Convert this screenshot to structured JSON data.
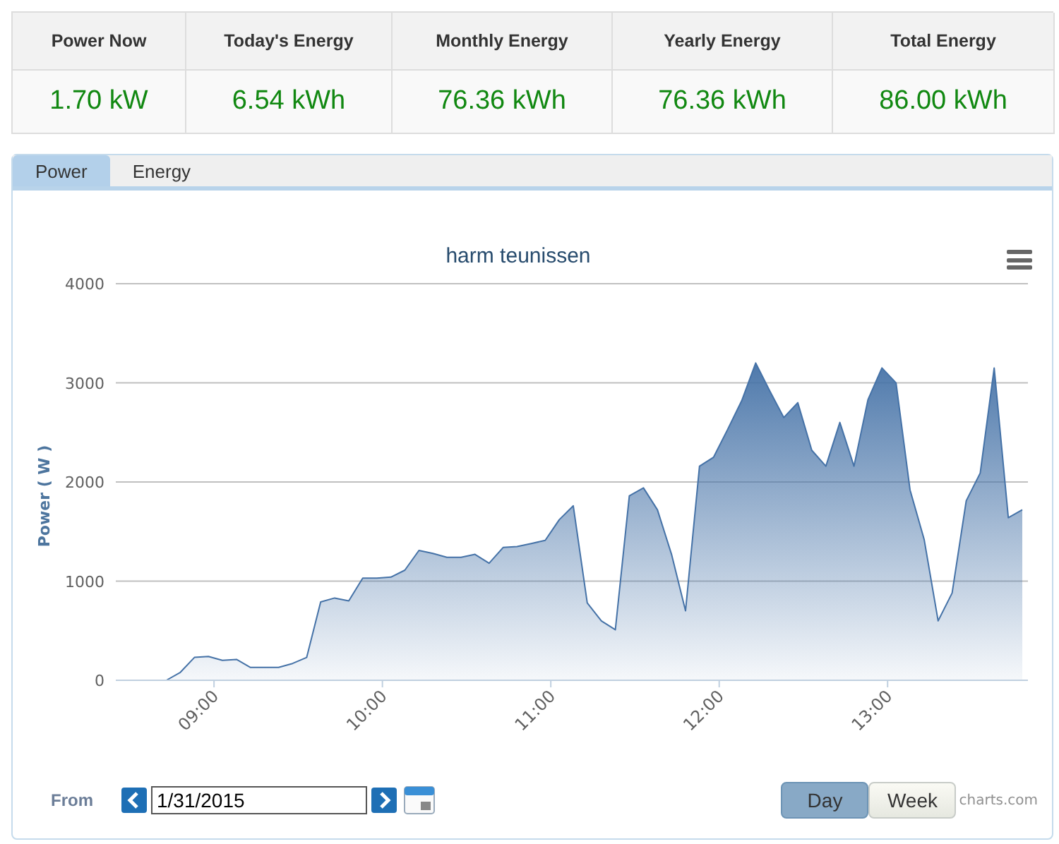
{
  "stats": [
    {
      "label": "Power Now",
      "value": "1.70 kW"
    },
    {
      "label": "Today's Energy",
      "value": "6.54 kWh"
    },
    {
      "label": "Monthly Energy",
      "value": "76.36 kWh"
    },
    {
      "label": "Yearly Energy",
      "value": "76.36 kWh"
    },
    {
      "label": "Total Energy",
      "value": "86.00 kWh"
    }
  ],
  "tabs": [
    {
      "label": "Power",
      "selected": true
    },
    {
      "label": "Energy",
      "selected": false
    }
  ],
  "chart_data": {
    "type": "area",
    "title": "harm teunissen",
    "ylabel": "Power ( W )",
    "x": [
      523,
      528,
      533,
      538,
      543,
      548,
      553,
      558,
      563,
      568,
      573,
      578,
      583,
      588,
      593,
      598,
      603,
      608,
      613,
      618,
      623,
      628,
      633,
      638,
      643,
      648,
      653,
      658,
      663,
      668,
      673,
      678,
      683,
      688,
      693,
      698,
      703,
      708,
      713,
      718,
      723,
      728,
      733,
      738,
      743,
      748,
      753,
      758,
      763,
      768,
      773,
      778,
      783,
      788,
      793,
      798,
      803,
      808,
      813,
      818,
      823,
      828
    ],
    "series": [
      {
        "color": "#4572a7",
        "values": [
          0,
          80,
          230,
          240,
          200,
          210,
          130,
          130,
          130,
          170,
          230,
          790,
          830,
          800,
          1030,
          1030,
          1040,
          1110,
          1310,
          1280,
          1240,
          1240,
          1270,
          1180,
          1340,
          1350,
          1380,
          1410,
          1620,
          1760,
          780,
          600,
          510,
          1860,
          1940,
          1720,
          1270,
          700,
          2160,
          2250,
          2530,
          2820,
          3200,
          2920,
          2650,
          2800,
          2320,
          2160,
          2600,
          2160,
          2830,
          3150,
          3000,
          1920,
          1420,
          600,
          880,
          1810,
          2090,
          3150,
          1640,
          1720
        ]
      }
    ],
    "xlim": [
      505,
      830
    ],
    "ylim": [
      0,
      4000
    ],
    "xticks": [
      {
        "value": 540,
        "label": "09:00"
      },
      {
        "value": 600,
        "label": "10:00"
      },
      {
        "value": 660,
        "label": "11:00"
      },
      {
        "value": 720,
        "label": "12:00"
      },
      {
        "value": 780,
        "label": "13:00"
      }
    ],
    "yticks": [
      0,
      1000,
      2000,
      3000,
      4000
    ],
    "grid": true
  },
  "from": {
    "label": "From",
    "value": "1/31/2015"
  },
  "ranges": [
    {
      "label": "Day",
      "selected": true
    },
    {
      "label": "Week",
      "selected": false
    }
  ],
  "credit": "charts.com"
}
